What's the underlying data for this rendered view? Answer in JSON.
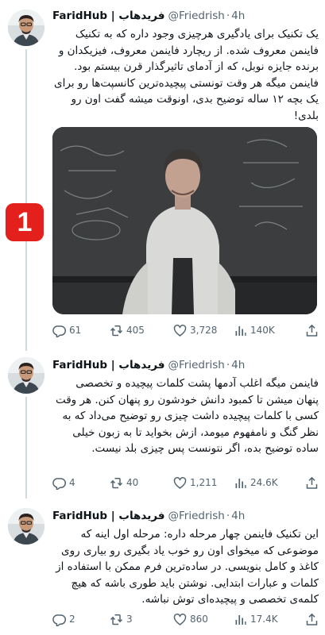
{
  "accent": "#1d9bf0",
  "badge": {
    "label": "1",
    "color": "#e3201b"
  },
  "tweets": [
    {
      "name": "FaridHub | فریدهاب",
      "handle": "@Friedrish",
      "separator": "·",
      "time": "4h",
      "text": "یک تکنیک برای یادگیری هرچیزی وجود داره که به تکنیک فاینمن معروف شده. از ریچارد فاینمن معروف، فیزیکدان و برنده جایزه نوبل، که از آدمای تاثیرگذار قرن بیستم بود. فاینمن میگه هر وقت تونستی پیچیده‌ترین کانسپت‌ها رو برای یک بچه ۱۲ ساله توضیح بدی، اونوقت میشه گفت اون رو بلدی!",
      "stats": {
        "replies": "61",
        "reposts": "405",
        "likes": "3,728",
        "views": "140K"
      }
    },
    {
      "name": "FaridHub | فریدهاب",
      "handle": "@Friedrish",
      "separator": "·",
      "time": "4h",
      "text": "فاینمن میگه اغلب آدمها پشت کلمات پیچیده و تخصصی پنهان میشن تا کمبود دانش خودشون رو پنهان کنن. هر وقت کسی با کلمات پیچیده داشت چیزی رو توضیح می‌داد که به نظر گنگ و نامفهوم میومد، ازش بخواید تا به زبون خیلی ساده توضیح بده، اگر نتونست پس چیزی بلد نیست.",
      "stats": {
        "replies": "4",
        "reposts": "40",
        "likes": "1,211",
        "views": "24.6K"
      }
    },
    {
      "name": "FaridHub | فریدهاب",
      "handle": "@Friedrish",
      "separator": "·",
      "time": "4h",
      "text": "این تکنیک فاینمن چهار مرحله داره: مرحله اول اینه که موضوعی که میخوای اون رو خوب یاد بگیری رو بیاری روی کاغذ و کامل بنویسی. در ساده‌ترین فرم ممکن با استفاده از کلمات و عبارات ابتدایی. نوشتن باید طوری باشه که هیچ کلمه‌ی تخصصی و پیچیده‌ای توش نباشه.",
      "stats": {
        "replies": "2",
        "reposts": "3",
        "likes": "860",
        "views": "17.4K"
      }
    }
  ]
}
